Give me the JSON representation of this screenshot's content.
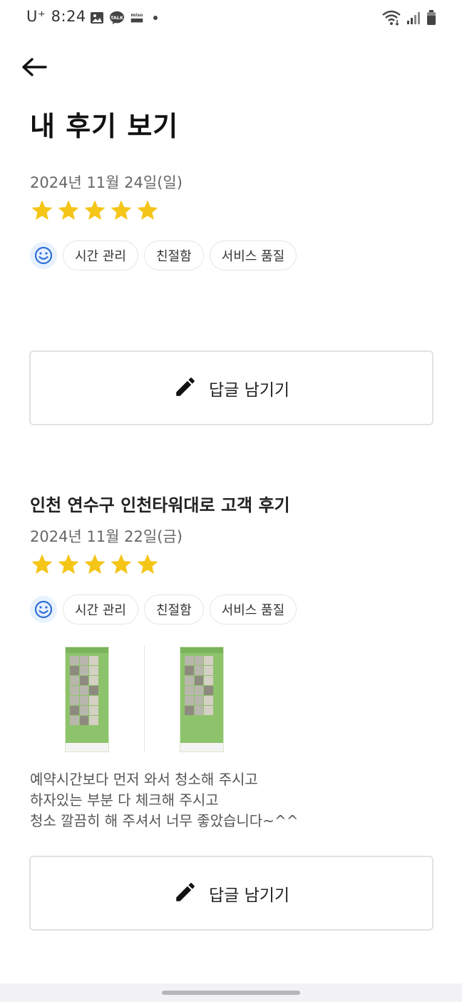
{
  "status_bar": {
    "carrier_time": "U⁺ 8:24",
    "left_icons": [
      "gallery-icon",
      "talk-icon",
      "miso-partner-icon",
      "notification-dot"
    ],
    "right_icons": [
      "wifi-icon",
      "signal-icon",
      "battery-icon"
    ]
  },
  "header": {
    "back_icon": "arrow-left-icon",
    "title": "내 후기 보기"
  },
  "reviews": [
    {
      "title": "",
      "date": "2024년 11월 24일(일)",
      "rating": 5,
      "tags": [
        "시간 관리",
        "친절함",
        "서비스 품질"
      ],
      "reply_label": "답글 남기기"
    },
    {
      "title": "인천 연수구 인천타워대로 고객 후기",
      "date": "2024년 11월 22일(금)",
      "rating": 5,
      "tags": [
        "시간 관리",
        "친절함",
        "서비스 품질"
      ],
      "photo_count": 2,
      "body": "예약시간보다 먼저 와서 청소해 주시고\n하자있는 부분 다 체크해 주시고\n청소 깔끔히 해 주셔서 너무 좋았습니다~^^",
      "reply_label": "답글 남기기"
    }
  ],
  "colors": {
    "star": "#F5C518",
    "smile_bg": "#E8F2FF",
    "smile_fg": "#2F6FD6"
  }
}
